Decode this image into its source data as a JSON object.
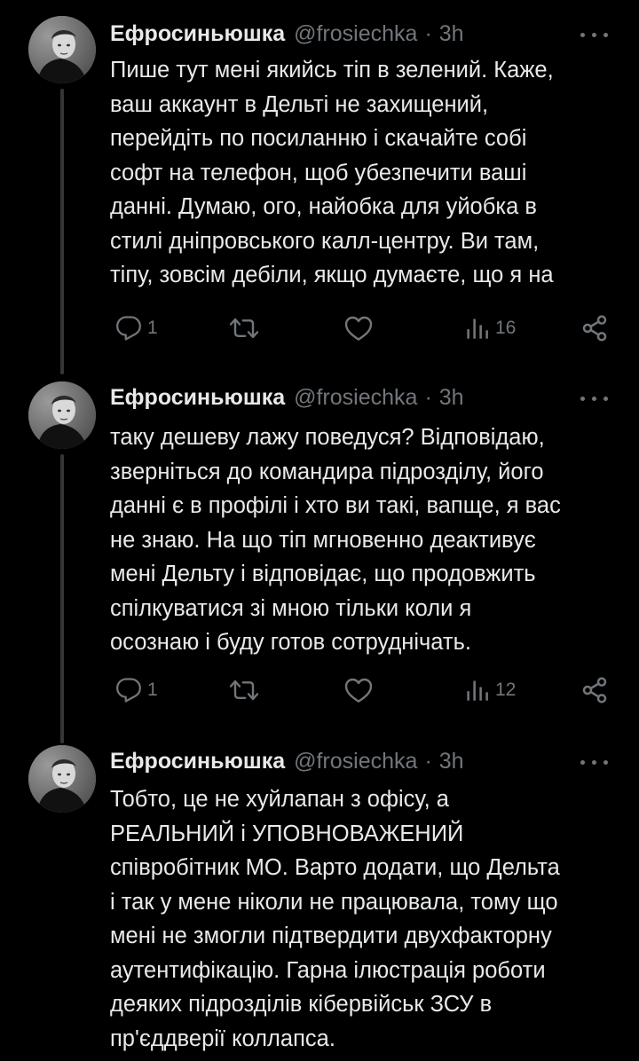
{
  "tweets": [
    {
      "display_name": "Ефросиньюшка",
      "handle": "@frosiechka",
      "separator": "·",
      "time": "3h",
      "text": "Пише тут мені якийсь тіп в зелений. Каже,\nваш аккаунт в Дельті не захищений,\nперейдіть по посиланню і скачайте собі\nсофт на телефон, щоб убезпечити ваші\nданні. Думаю, ого, найобка для уйобка в\nстилі дніпровського калл-центру. Ви там,\nтіпу, зовсім дебіли, якщо думаєте, що я на",
      "reply_count": "1",
      "view_count": "16",
      "icons": [
        "reply-icon",
        "retweet-icon",
        "like-icon",
        "views-icon",
        "share-icon",
        "more-icon"
      ]
    },
    {
      "display_name": "Ефросиньюшка",
      "handle": "@frosiechka",
      "separator": "·",
      "time": "3h",
      "text": "таку дешеву лажу поведуся? Відповідаю,\nзверніться до командира підрозділу, його\nданні є в профілі і хто ви такі, вапще, я вас\nне знаю. На що тіп мгновенно деактивує\nмені Дельту і відповідає, що продовжить\nспілкуватися зі мною тільки коли я\nосознаю і буду готов сотруднічать.",
      "reply_count": "1",
      "view_count": "12",
      "icons": [
        "reply-icon",
        "retweet-icon",
        "like-icon",
        "views-icon",
        "share-icon",
        "more-icon"
      ]
    },
    {
      "display_name": "Ефросиньюшка",
      "handle": "@frosiechka",
      "separator": "·",
      "time": "3h",
      "text": "Тобто, це не хуйлапан з офісу, а\nРЕАЛЬНИЙ і УПОВНОВАЖЕНИЙ\nспівробітник МО. Варто додати, що Дельта\nі так у мене ніколи не працювала, тому що\nмені не змогли підтвердити двухфакторну\nаутентифікацію. Гарна ілюстрація роботи\nдеяких підрозділів кібервійськ ЗСУ в\nпр'єддверії коллапса.",
      "icons": [
        "more-icon"
      ]
    }
  ],
  "colors": {
    "background": "#000000",
    "text": "#e7e9ea",
    "secondary": "#71767b",
    "thread_line": "#333639"
  }
}
